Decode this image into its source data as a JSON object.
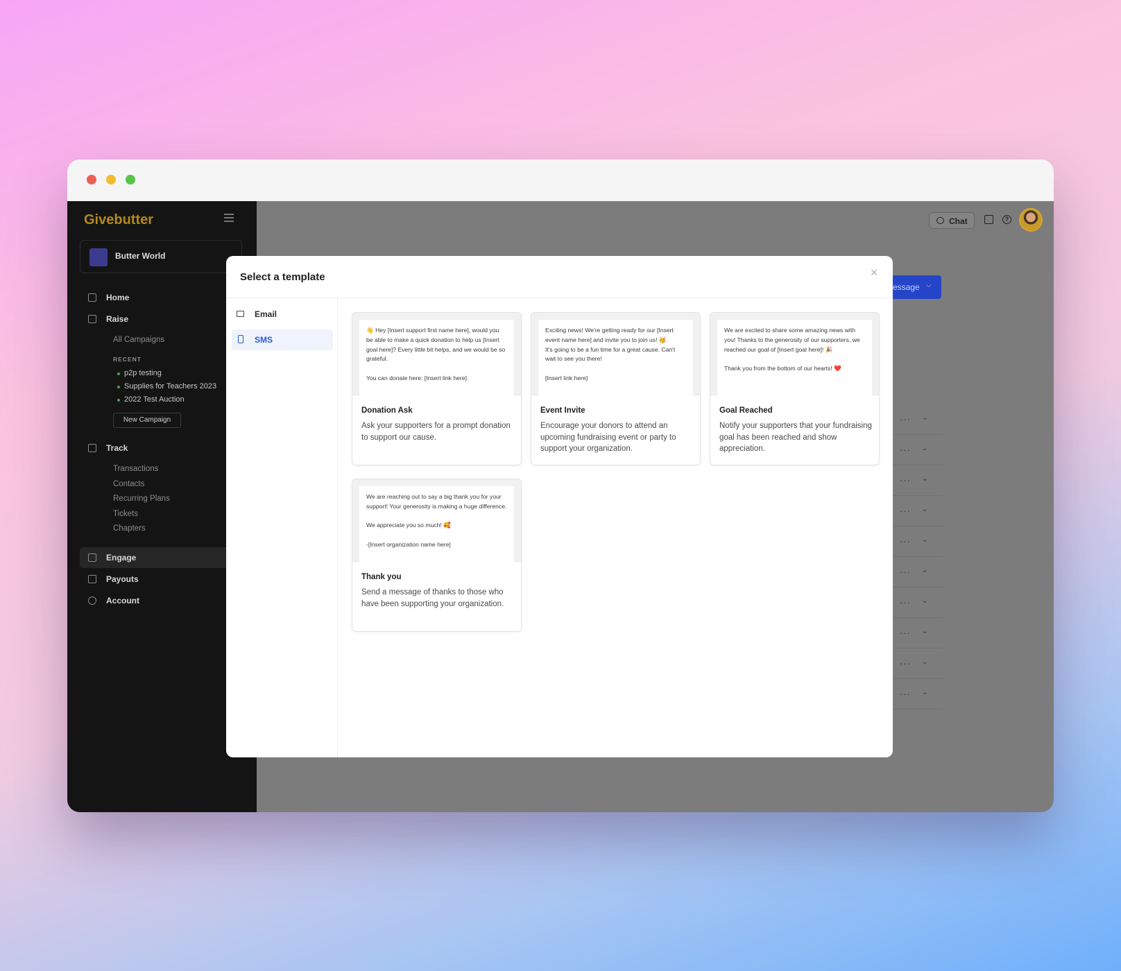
{
  "app": {
    "brand": "Givebutter",
    "org_name": "Butter World"
  },
  "sidebar": {
    "home": "Home",
    "raise": "Raise",
    "all_campaigns": "All Campaigns",
    "recent_heading": "RECENT",
    "recent": [
      "p2p testing",
      "Supplies for Teachers 2023",
      "2022 Test Auction"
    ],
    "new_campaign": "New Campaign",
    "track": "Track",
    "track_items": [
      "Transactions",
      "Contacts",
      "Recurring Plans",
      "Tickets",
      "Chapters"
    ],
    "engage": "Engage",
    "payouts": "Payouts",
    "account": "Account"
  },
  "topbar": {
    "chat_label": "Chat"
  },
  "background": {
    "button_label": "essage",
    "row_dots": "···",
    "row_chevron": "⌄"
  },
  "modal": {
    "title": "Select a template",
    "close": "×",
    "tabs": [
      {
        "label": "Email",
        "icon": "mail-icon"
      },
      {
        "label": "SMS",
        "icon": "phone-icon"
      }
    ],
    "templates": [
      {
        "preview": "👋 Hey [Insert support first name here], would you be able to make a quick donation to help us [Insert goal here]? Every little bit helps, and we would be so grateful.\n\nYou can donate here: [Insert link here].",
        "title": "Donation Ask",
        "description": "Ask your supporters for a prompt donation to support our cause."
      },
      {
        "preview": "Exciting news! We're getting ready for our [Insert event name here] and invite you to join us! 🥳\nIt's going to be a fun time for a great cause. Can't wait to see you there!\n\n[Insert link here]",
        "title": "Event Invite",
        "description": "Encourage your donors to attend an upcoming fundraising event or party to support your organization."
      },
      {
        "preview": "We are excited to share some amazing news with you! Thanks to the generosity of our supporters, we reached our goal of [Insert goal here]! 🎉\n\nThank you from the bottom of our hearts! ❤️",
        "title": "Goal Reached",
        "description": "Notify your supporters that your fundraising goal has been reached and show appreciation."
      },
      {
        "preview": "We are reaching out to say a big thank you for your support! Your generosity is making a huge difference.\n\nWe appreciate you so much! 🥰\n\n-[Insert organization name here]",
        "title": "Thank you",
        "description": "Send a message of thanks to those who have been supporting your organization."
      }
    ]
  }
}
